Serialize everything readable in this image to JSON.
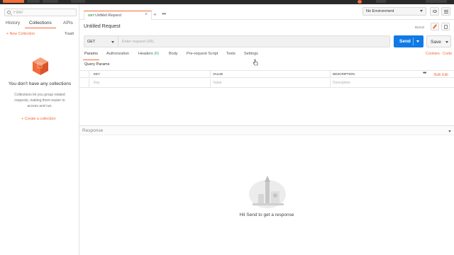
{
  "sidebar": {
    "filter_placeholder": "Filter",
    "tabs": [
      "History",
      "Collections",
      "APIs"
    ],
    "active_tab": "Collections",
    "new_collection": "+ New Collection",
    "trash": "Trash",
    "empty_title": "You don't have any collections",
    "empty_desc": "Collections let you group related requests, making them easier to access and run.",
    "create_link": "+   Create a collection"
  },
  "header": {
    "request_tab": {
      "method": "GET",
      "name": "Untitled Request",
      "close": "×"
    },
    "plus": "+",
    "more": "•••",
    "environment": "No Environment"
  },
  "request": {
    "title": "Untitled Request",
    "build_label": "BUILD",
    "method": "GET",
    "url_placeholder": "Enter request URL",
    "send": "Send",
    "save": "Save"
  },
  "subtabs": {
    "params": "Params",
    "authorization": "Authorization",
    "headers": "Headers",
    "headers_count": "(6)",
    "body": "Body",
    "prerequest": "Pre-request Script",
    "tests": "Tests",
    "settings": "Settings",
    "cookies": "Cookies",
    "code": "Code"
  },
  "params": {
    "label": "Query Params",
    "columns": {
      "key": "KEY",
      "value": "VALUE",
      "description": "DESCRIPTION"
    },
    "placeholders": {
      "key": "Key",
      "value": "Value",
      "description": "Description"
    },
    "more": "•••",
    "bulk_edit": "Bulk Edit"
  },
  "response": {
    "label": "Response",
    "hint": "Hit Send to get a response"
  },
  "colors": {
    "accent": "#f26b3a",
    "send_blue": "#0f7ae5",
    "get_green": "#3aa55d"
  }
}
